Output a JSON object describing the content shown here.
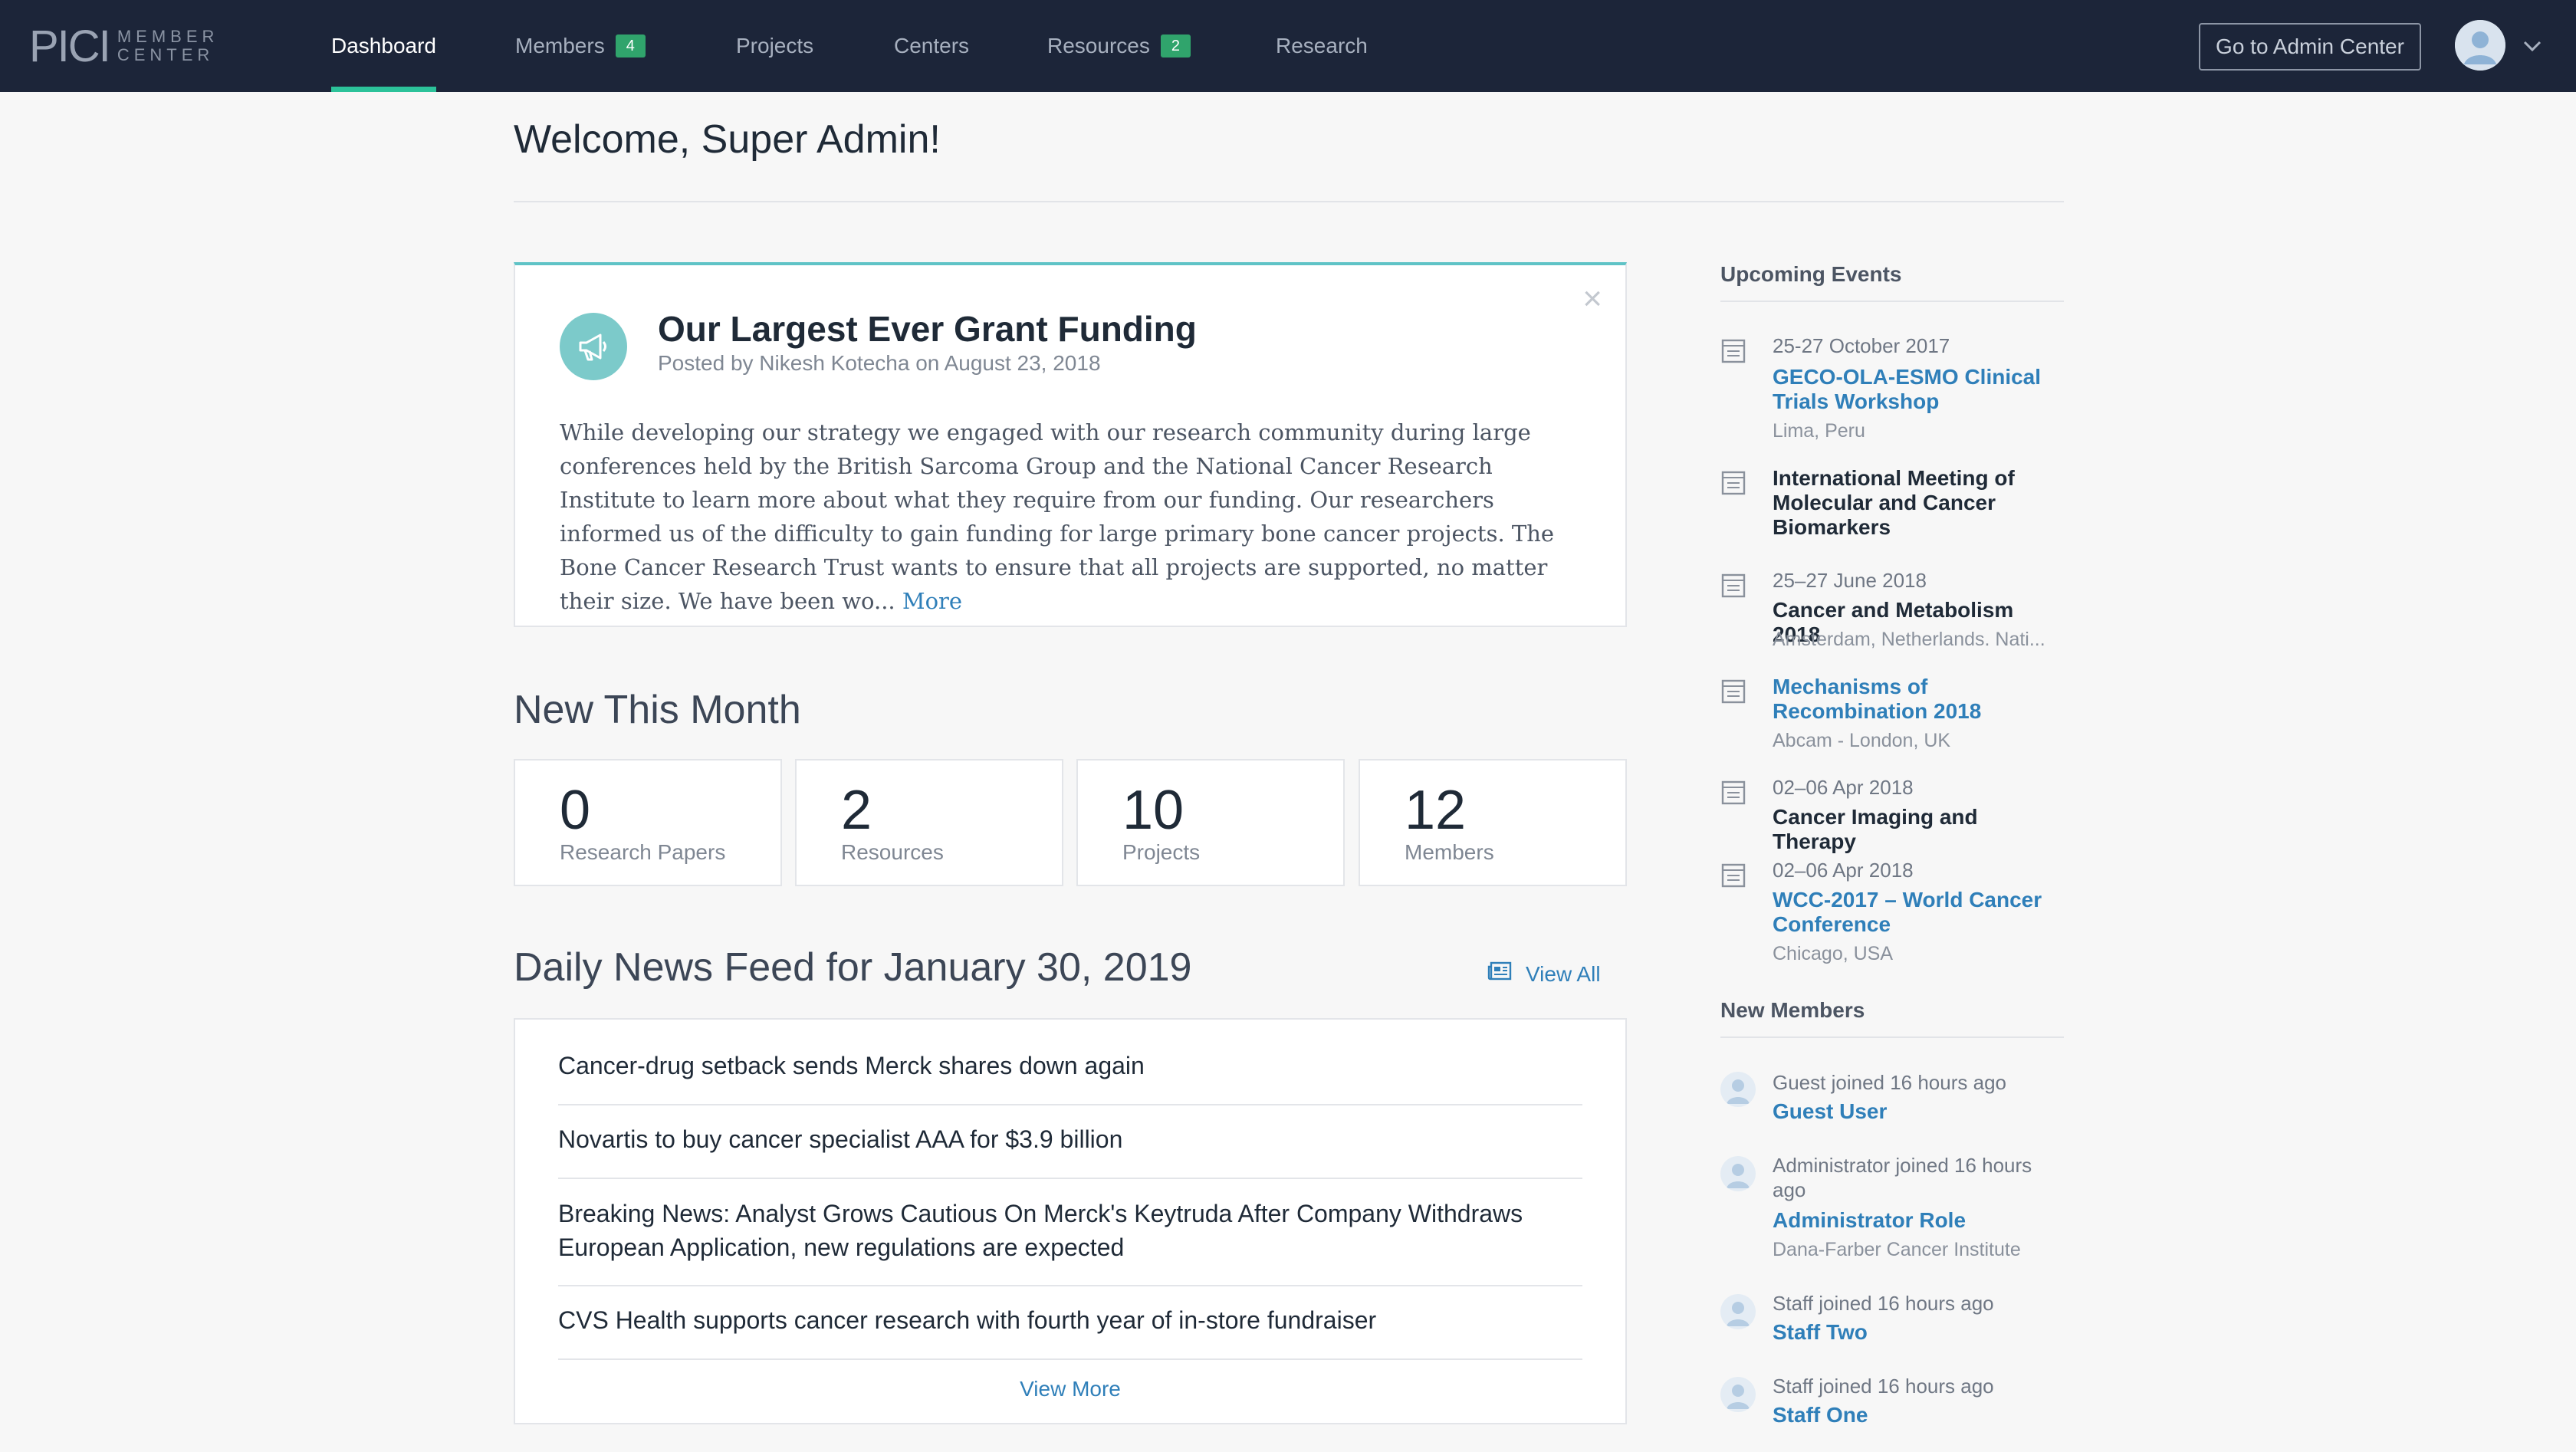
{
  "brand": {
    "logo_main": "PICI",
    "logo_line1": "MEMBER",
    "logo_line2": "CENTER"
  },
  "nav": {
    "items": [
      {
        "label": "Dashboard",
        "badge": ""
      },
      {
        "label": "Members",
        "badge": "4"
      },
      {
        "label": "Projects",
        "badge": ""
      },
      {
        "label": "Centers",
        "badge": ""
      },
      {
        "label": "Resources",
        "badge": "2"
      },
      {
        "label": "Research",
        "badge": ""
      }
    ],
    "active": "Dashboard",
    "admin_button": "Go to Admin Center"
  },
  "page": {
    "title": "Welcome, Super Admin!"
  },
  "announcement": {
    "title": "Our Largest Ever Grant Funding",
    "meta": "Posted by Nikesh Kotecha on August 23, 2018",
    "body": "While developing our strategy we engaged with our research community during large conferences held by the British Sarcoma Group and the National Cancer Research Institute to learn more about what they require from our funding. Our researchers informed us of the difficulty to gain funding for large primary bone cancer projects. The Bone Cancer Research Trust wants to ensure that all projects are supported, no matter their size. We have been wo...",
    "more": "More",
    "close": "×"
  },
  "new_this_month": {
    "heading": "New This Month",
    "stats": [
      {
        "value": "0",
        "label": "Research Papers"
      },
      {
        "value": "2",
        "label": "Resources"
      },
      {
        "value": "10",
        "label": "Projects"
      },
      {
        "value": "12",
        "label": "Members"
      }
    ]
  },
  "news": {
    "heading": "Daily News Feed for January 30, 2019",
    "view_all": "View All",
    "items": [
      "Cancer-drug setback sends Merck shares down again",
      "Novartis to buy cancer specialist AAA for $3.9 billion",
      "Breaking News: Analyst Grows Cautious On Merck's Keytruda After Company Withdraws European Application, new regulations are expected",
      "CVS Health supports cancer research with fourth year of in-store fundraiser"
    ],
    "view_more": "View More"
  },
  "events": {
    "heading": "Upcoming Events",
    "items": [
      {
        "date": "25-27 October 2017",
        "title": "GECO-OLA-ESMO Clinical Trials Workshop",
        "location": "Lima, Peru"
      },
      {
        "date": "",
        "title": "International Meeting of Molecular and Cancer Biomarkers",
        "location": ""
      },
      {
        "date": "25–27 June 2018",
        "title": "Cancer and Metabolism 2018",
        "location": "Amsterdam, Netherlands. Nati..."
      },
      {
        "date": "",
        "title": "Mechanisms of Recombination 2018",
        "location": "Abcam - London, UK"
      },
      {
        "date": "02–06 Apr 2018",
        "title": "Cancer Imaging and Therapy",
        "location": ""
      },
      {
        "date": "02–06 Apr 2018",
        "title": "WCC-2017 – World Cancer Conference",
        "location": "Chicago, USA"
      }
    ]
  },
  "new_members": {
    "heading": "New Members",
    "items": [
      {
        "joined": "Guest joined 16 hours ago",
        "name": "Guest User",
        "org": ""
      },
      {
        "joined": "Administrator joined 16 hours ago",
        "name": "Administrator Role",
        "org": "Dana-Farber Cancer Institute"
      },
      {
        "joined": "Staff joined 16 hours ago",
        "name": "Staff Two",
        "org": ""
      },
      {
        "joined": "Staff joined 16 hours ago",
        "name": "Staff One",
        "org": ""
      }
    ]
  },
  "colors": {
    "nav_bg": "#1c2539",
    "accent_green": "#2cc29a",
    "badge_green": "#30a46c",
    "link_blue": "#2f7fb9",
    "announce_teal": "#7ccaca"
  },
  "icons": [
    "megaphone-icon",
    "close-icon",
    "calendar-icon",
    "newspaper-icon",
    "user-avatar-icon",
    "chevron-down-icon"
  ]
}
